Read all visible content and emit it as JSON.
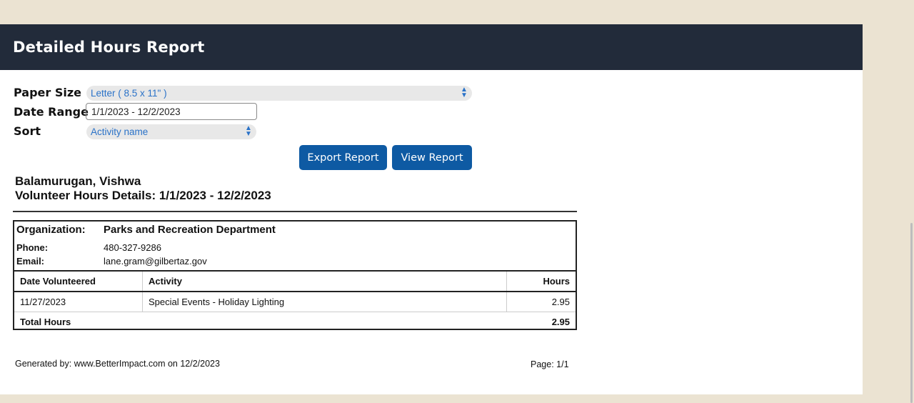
{
  "header": {
    "title": "Detailed Hours Report"
  },
  "form": {
    "paper_size": {
      "label": "Paper Size",
      "value": "Letter ( 8.5 x 11\" )"
    },
    "date_range": {
      "label": "Date Range",
      "value": "1/1/2023 - 12/2/2023"
    },
    "sort": {
      "label": "Sort",
      "value": "Activity name"
    },
    "export_label": "Export Report",
    "view_label": "View Report"
  },
  "report": {
    "name": "Balamurugan, Vishwa",
    "subtitle": "Volunteer Hours Details: 1/1/2023 - 12/2/2023",
    "organization": {
      "label": "Organization:",
      "value": "Parks and Recreation Department",
      "phone_label": "Phone:",
      "phone": "480-327-9286",
      "email_label": "Email:",
      "email": "lane.gram@gilbertaz.gov"
    },
    "table": {
      "headers": [
        "Date Volunteered",
        "Activity",
        "Hours"
      ],
      "rows": [
        [
          "11/27/2023",
          "Special Events - Holiday Lighting",
          "2.95"
        ]
      ],
      "total_label": "Total Hours",
      "total_value": "2.95"
    },
    "footer": {
      "generated": "Generated by: www.BetterImpact.com on 12/2/2023",
      "page": "Page: 1/1"
    }
  }
}
